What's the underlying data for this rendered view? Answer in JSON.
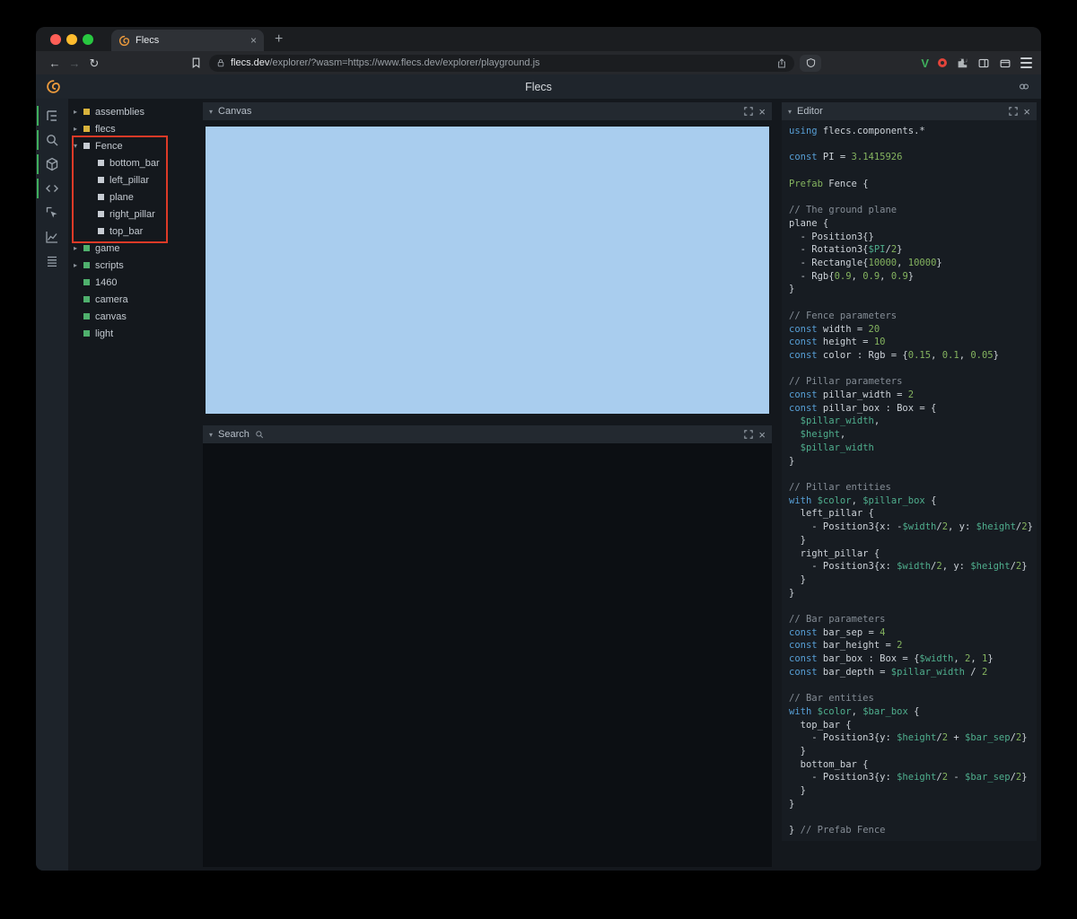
{
  "browser": {
    "tab_title": "Flecs",
    "url_host": "flecs.dev",
    "url_rest": "/explorer/?wasm=https://www.flecs.dev/explorer/playground.js"
  },
  "app": {
    "title": "Flecs"
  },
  "icons": {
    "new_tab": "+",
    "close": "×",
    "back": "←",
    "forward": "→",
    "reload": "↻",
    "chevron_down": "▾",
    "chevron_right": "▸"
  },
  "rail_icons": [
    "entity-tree",
    "search",
    "scene",
    "code",
    "inspect",
    "statistics",
    "queries"
  ],
  "panels": {
    "canvas": {
      "title": "Canvas"
    },
    "search": {
      "title": "Search"
    },
    "editor": {
      "title": "Editor"
    }
  },
  "colors": {
    "canvas_blue": "#a9cdee",
    "entity_yellow": "#d9b33c",
    "entity_green": "#4fb06d",
    "entity_white": "#c7ccd3",
    "accent_green": "#3fae5c",
    "annotation_red": "#dd3a27"
  },
  "tree": {
    "items": [
      {
        "label": "assemblies",
        "color": "yellow",
        "state": "collapsed",
        "depth": 0
      },
      {
        "label": "flecs",
        "color": "yellow",
        "state": "collapsed",
        "depth": 0
      },
      {
        "label": "Fence",
        "color": "white",
        "state": "expanded",
        "depth": 0
      },
      {
        "label": "bottom_bar",
        "color": "white",
        "state": "none",
        "depth": 1
      },
      {
        "label": "left_pillar",
        "color": "white",
        "state": "none",
        "depth": 1
      },
      {
        "label": "plane",
        "color": "white",
        "state": "none",
        "depth": 1
      },
      {
        "label": "right_pillar",
        "color": "white",
        "state": "none",
        "depth": 1
      },
      {
        "label": "top_bar",
        "color": "white",
        "state": "none",
        "depth": 1
      },
      {
        "label": "game",
        "color": "green",
        "state": "collapsed",
        "depth": 0
      },
      {
        "label": "scripts",
        "color": "green",
        "state": "collapsed",
        "depth": 0
      },
      {
        "label": "1460",
        "color": "green",
        "state": "none",
        "depth": 0
      },
      {
        "label": "camera",
        "color": "green",
        "state": "none",
        "depth": 0
      },
      {
        "label": "canvas",
        "color": "green",
        "state": "none",
        "depth": 0
      },
      {
        "label": "light",
        "color": "green",
        "state": "none",
        "depth": 0
      }
    ]
  },
  "editor": {
    "lines": [
      [
        [
          "kw",
          "using"
        ],
        [
          "txt",
          " flecs.components.*"
        ]
      ],
      [],
      [
        [
          "kw",
          "const"
        ],
        [
          "txt",
          " PI = "
        ],
        [
          "grn",
          "3.1415926"
        ]
      ],
      [],
      [
        [
          "grn",
          "Prefab"
        ],
        [
          "txt",
          " Fence {"
        ]
      ],
      [],
      [
        [
          "cmt",
          "// The ground plane"
        ]
      ],
      [
        [
          "txt",
          "plane {"
        ]
      ],
      [
        [
          "txt",
          "  - Position3{}"
        ]
      ],
      [
        [
          "txt",
          "  - Rotation3{"
        ],
        [
          "var",
          "$PI"
        ],
        [
          "txt",
          "/"
        ],
        [
          "grn",
          "2"
        ],
        [
          "txt",
          "}"
        ]
      ],
      [
        [
          "txt",
          "  - Rectangle{"
        ],
        [
          "grn",
          "10000"
        ],
        [
          "txt",
          ", "
        ],
        [
          "grn",
          "10000"
        ],
        [
          "txt",
          "}"
        ]
      ],
      [
        [
          "txt",
          "  - Rgb{"
        ],
        [
          "grn",
          "0.9"
        ],
        [
          "txt",
          ", "
        ],
        [
          "grn",
          "0.9"
        ],
        [
          "txt",
          ", "
        ],
        [
          "grn",
          "0.9"
        ],
        [
          "txt",
          "}"
        ]
      ],
      [
        [
          "txt",
          "}"
        ]
      ],
      [],
      [
        [
          "cmt",
          "// Fence parameters"
        ]
      ],
      [
        [
          "kw",
          "const"
        ],
        [
          "txt",
          " width = "
        ],
        [
          "grn",
          "20"
        ]
      ],
      [
        [
          "kw",
          "const"
        ],
        [
          "txt",
          " height = "
        ],
        [
          "grn",
          "10"
        ]
      ],
      [
        [
          "kw",
          "const"
        ],
        [
          "txt",
          " color : Rgb = {"
        ],
        [
          "grn",
          "0.15"
        ],
        [
          "txt",
          ", "
        ],
        [
          "grn",
          "0.1"
        ],
        [
          "txt",
          ", "
        ],
        [
          "grn",
          "0.05"
        ],
        [
          "txt",
          "}"
        ]
      ],
      [],
      [
        [
          "cmt",
          "// Pillar parameters"
        ]
      ],
      [
        [
          "kw",
          "const"
        ],
        [
          "txt",
          " pillar_width = "
        ],
        [
          "grn",
          "2"
        ]
      ],
      [
        [
          "kw",
          "const"
        ],
        [
          "txt",
          " pillar_box : Box = {"
        ]
      ],
      [
        [
          "txt",
          "  "
        ],
        [
          "var",
          "$pillar_width"
        ],
        [
          "txt",
          ","
        ]
      ],
      [
        [
          "txt",
          "  "
        ],
        [
          "var",
          "$height"
        ],
        [
          "txt",
          ","
        ]
      ],
      [
        [
          "txt",
          "  "
        ],
        [
          "var",
          "$pillar_width"
        ]
      ],
      [
        [
          "txt",
          "}"
        ]
      ],
      [],
      [
        [
          "cmt",
          "// Pillar entities"
        ]
      ],
      [
        [
          "kw",
          "with"
        ],
        [
          "txt",
          " "
        ],
        [
          "var",
          "$color"
        ],
        [
          "txt",
          ", "
        ],
        [
          "var",
          "$pillar_box"
        ],
        [
          "txt",
          " {"
        ]
      ],
      [
        [
          "txt",
          "  left_pillar {"
        ]
      ],
      [
        [
          "txt",
          "    - Position3{x: -"
        ],
        [
          "var",
          "$width"
        ],
        [
          "txt",
          "/"
        ],
        [
          "grn",
          "2"
        ],
        [
          "txt",
          ", y: "
        ],
        [
          "var",
          "$height"
        ],
        [
          "txt",
          "/"
        ],
        [
          "grn",
          "2"
        ],
        [
          "txt",
          "}"
        ]
      ],
      [
        [
          "txt",
          "  }"
        ]
      ],
      [
        [
          "txt",
          "  right_pillar {"
        ]
      ],
      [
        [
          "txt",
          "    - Position3{x: "
        ],
        [
          "var",
          "$width"
        ],
        [
          "txt",
          "/"
        ],
        [
          "grn",
          "2"
        ],
        [
          "txt",
          ", y: "
        ],
        [
          "var",
          "$height"
        ],
        [
          "txt",
          "/"
        ],
        [
          "grn",
          "2"
        ],
        [
          "txt",
          "}"
        ]
      ],
      [
        [
          "txt",
          "  }"
        ]
      ],
      [
        [
          "txt",
          "}"
        ]
      ],
      [],
      [
        [
          "cmt",
          "// Bar parameters"
        ]
      ],
      [
        [
          "kw",
          "const"
        ],
        [
          "txt",
          " bar_sep = "
        ],
        [
          "grn",
          "4"
        ]
      ],
      [
        [
          "kw",
          "const"
        ],
        [
          "txt",
          " bar_height = "
        ],
        [
          "grn",
          "2"
        ]
      ],
      [
        [
          "kw",
          "const"
        ],
        [
          "txt",
          " bar_box : Box = {"
        ],
        [
          "var",
          "$width"
        ],
        [
          "txt",
          ", "
        ],
        [
          "grn",
          "2"
        ],
        [
          "txt",
          ", "
        ],
        [
          "grn",
          "1"
        ],
        [
          "txt",
          "}"
        ]
      ],
      [
        [
          "kw",
          "const"
        ],
        [
          "txt",
          " bar_depth = "
        ],
        [
          "var",
          "$pillar_width"
        ],
        [
          "txt",
          " / "
        ],
        [
          "grn",
          "2"
        ]
      ],
      [],
      [
        [
          "cmt",
          "// Bar entities"
        ]
      ],
      [
        [
          "kw",
          "with"
        ],
        [
          "txt",
          " "
        ],
        [
          "var",
          "$color"
        ],
        [
          "txt",
          ", "
        ],
        [
          "var",
          "$bar_box"
        ],
        [
          "txt",
          " {"
        ]
      ],
      [
        [
          "txt",
          "  top_bar {"
        ]
      ],
      [
        [
          "txt",
          "    - Position3{y: "
        ],
        [
          "var",
          "$height"
        ],
        [
          "txt",
          "/"
        ],
        [
          "grn",
          "2"
        ],
        [
          "txt",
          " + "
        ],
        [
          "var",
          "$bar_sep"
        ],
        [
          "txt",
          "/"
        ],
        [
          "grn",
          "2"
        ],
        [
          "txt",
          "}"
        ]
      ],
      [
        [
          "txt",
          "  }"
        ]
      ],
      [
        [
          "txt",
          "  bottom_bar {"
        ]
      ],
      [
        [
          "txt",
          "    - Position3{y: "
        ],
        [
          "var",
          "$height"
        ],
        [
          "txt",
          "/"
        ],
        [
          "grn",
          "2"
        ],
        [
          "txt",
          " - "
        ],
        [
          "var",
          "$bar_sep"
        ],
        [
          "txt",
          "/"
        ],
        [
          "grn",
          "2"
        ],
        [
          "txt",
          "}"
        ]
      ],
      [
        [
          "txt",
          "  }"
        ]
      ],
      [
        [
          "txt",
          "}"
        ]
      ],
      [],
      [
        [
          "txt",
          "} "
        ],
        [
          "cmt",
          "// Prefab Fence"
        ]
      ]
    ]
  }
}
